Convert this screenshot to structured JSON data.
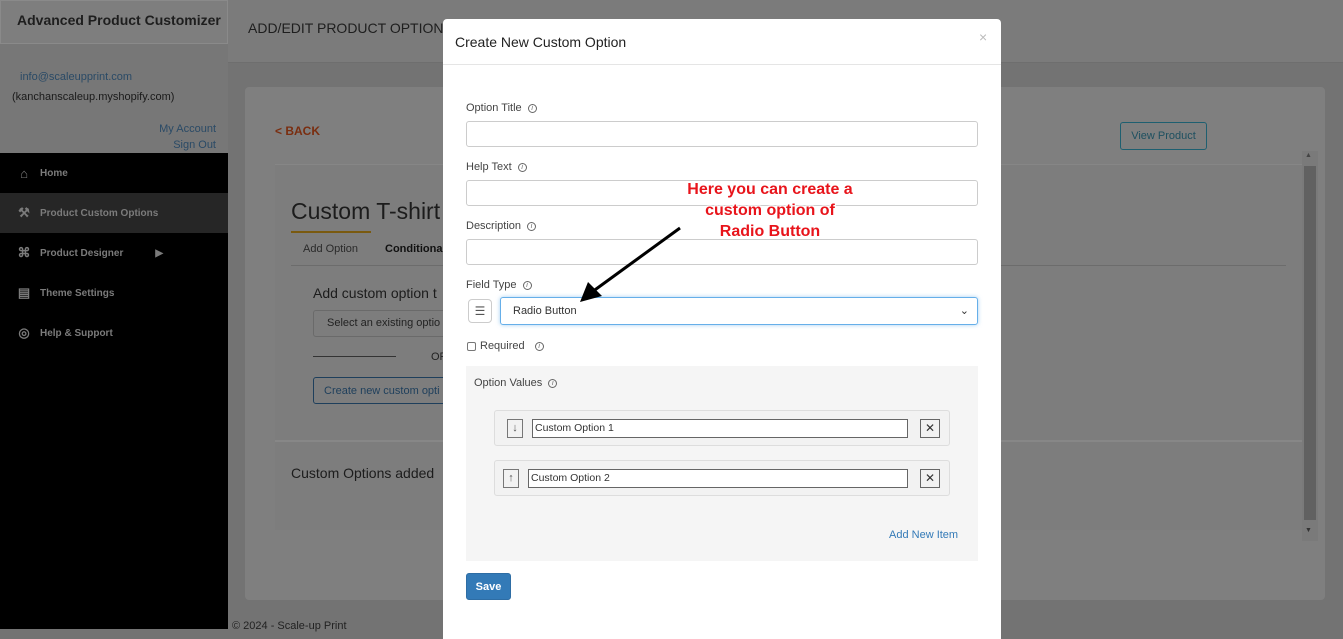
{
  "app": {
    "brand": "Advanced Product Customizer",
    "email": "info@scaleupprint.com",
    "store": "(kanchanscaleup.myshopify.com)",
    "my_account": "My Account",
    "sign_out": "Sign Out"
  },
  "nav": [
    {
      "label": "Home",
      "icon": "home-icon"
    },
    {
      "label": "Product Custom Options",
      "icon": "tools-icon",
      "active": true
    },
    {
      "label": "Product Designer",
      "icon": "designer-icon"
    },
    {
      "label": "Theme Settings",
      "icon": "theme-settings-icon"
    },
    {
      "label": "Help & Support",
      "icon": "lifebuoy-icon"
    }
  ],
  "header": {
    "title": "ADD/EDIT PRODUCT OPTIONS"
  },
  "page": {
    "back": "< BACK",
    "view_product": "View Product",
    "product_title": "Custom T-shirt",
    "tabs": [
      "Add Option",
      "Conditional"
    ],
    "add_heading": "Add custom option t",
    "select_placeholder": "Select an existing optio",
    "or": "OR",
    "create_button": "Create new custom opti",
    "added_heading": "Custom Options added",
    "footer": "© 2024 - Scale-up Print"
  },
  "modal": {
    "title": "Create New Custom Option",
    "close": "×",
    "option_title_label": "Option Title",
    "help_text_label": "Help Text",
    "description_label": "Description",
    "field_type_label": "Field Type",
    "field_type_value": "Radio Button",
    "required_label": "Required",
    "option_values_label": "Option Values",
    "values": [
      "Custom Option 1",
      "Custom Option 2"
    ],
    "add_new_item": "Add New Item",
    "save": "Save"
  },
  "annotation": {
    "line1": "Here you can create a",
    "line2": "custom option of",
    "line3": "Radio Button"
  },
  "colors": {
    "accent": "#337ab7",
    "annotation": "#e8141b"
  }
}
